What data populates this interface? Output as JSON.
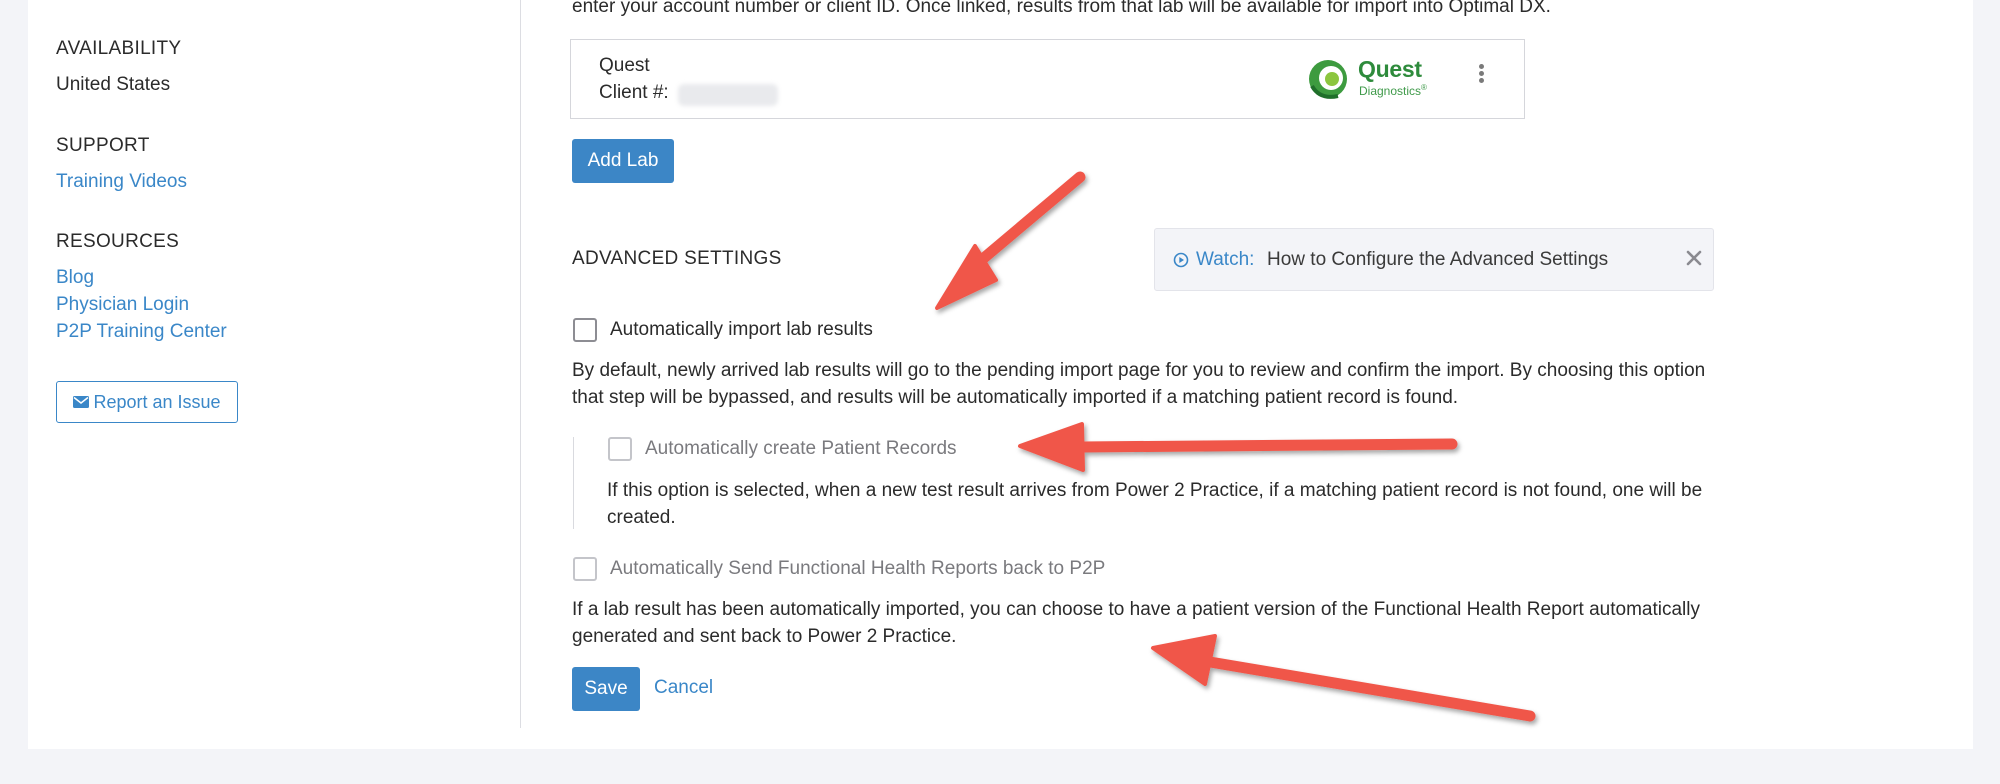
{
  "sidebar": {
    "availability_heading": "AVAILABILITY",
    "availability_value": "United States",
    "support_heading": "SUPPORT",
    "support_links": [
      "Training Videos"
    ],
    "resources_heading": "RESOURCES",
    "resources_links": [
      "Blog",
      "Physician Login",
      "P2P Training Center"
    ],
    "report_issue_label": "Report an Issue",
    "report_issue_icon": "envelope-icon"
  },
  "labs": {
    "intro_text": "enter your account number or client ID. Once linked, results from that lab will be available for import into Optimal DX.",
    "lab_name": "Quest",
    "client_label": "Client #:",
    "logo_word": "Quest",
    "logo_sub": "Diagnostics",
    "logo_reg": "®",
    "add_lab_label": "Add Lab"
  },
  "advanced": {
    "title": "ADVANCED SETTINGS",
    "watch_label": "Watch:",
    "watch_text": "How to Configure the Advanced Settings",
    "option1_label": "Automatically import lab results",
    "option1_desc": "By default, newly arrived lab results will go to the pending import page for you to review and confirm the import. By choosing this option that step will be bypassed, and results will be automatically imported if a matching patient record is found.",
    "option2_label": "Automatically create Patient Records",
    "option2_desc": "If this option is selected, when a new test result arrives from Power 2 Practice, if a matching patient record is not found, one will be created.",
    "option3_label": "Automatically Send Functional Health Reports back to P2P",
    "option3_desc": "If a lab result has been automatically imported, you can choose to have a patient version of the Functional Health Report automatically generated and sent back to Power 2 Practice.",
    "save_label": "Save",
    "cancel_label": "Cancel"
  },
  "colors": {
    "link": "#3a87c8",
    "primary_button": "#3c86c6",
    "annotation_arrow": "#f0564a",
    "quest_green": "#2e8b3c"
  }
}
